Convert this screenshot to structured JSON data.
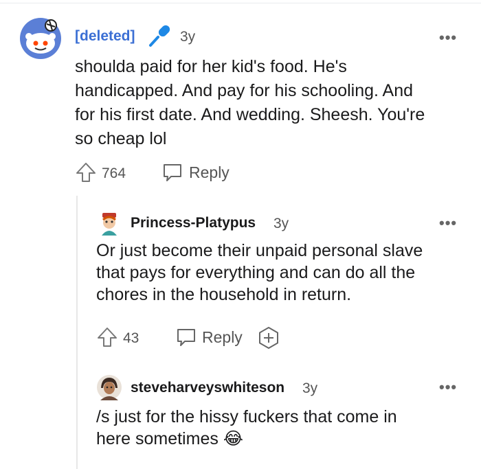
{
  "comments": [
    {
      "author": "[deleted]",
      "age": "3y",
      "lines": [
        "shoulda paid for her kid's food. He's",
        "handicapped. And pay for his schooling. And",
        "for his first date. And wedding. Sheesh. You're",
        "so cheap lol"
      ],
      "votes": "764",
      "reply_label": "Reply",
      "more_label": "•••"
    },
    {
      "author": "Princess-Platypus",
      "age": "3y",
      "lines": [
        "Or just become their unpaid personal slave",
        "that pays for everything and can do all the",
        "chores in the household in return."
      ],
      "votes": "43",
      "reply_label": "Reply",
      "more_label": "•••"
    },
    {
      "author": "steveharveyswhiteson",
      "age": "3y",
      "lines": [
        "/s just for the hissy fuckers that come in",
        "here sometimes"
      ],
      "emoji": "😂",
      "more_label": "•••"
    }
  ],
  "icons": {
    "c1_avatar": "snoo-avatar-icon",
    "c1_badge": "microphone-icon",
    "upvote": "upvote-arrow-icon",
    "reply": "speech-bubble-icon",
    "award": "add-award-icon"
  },
  "colors": {
    "deleted_author": "#3b6fd4",
    "badge": "#1e88e5"
  }
}
